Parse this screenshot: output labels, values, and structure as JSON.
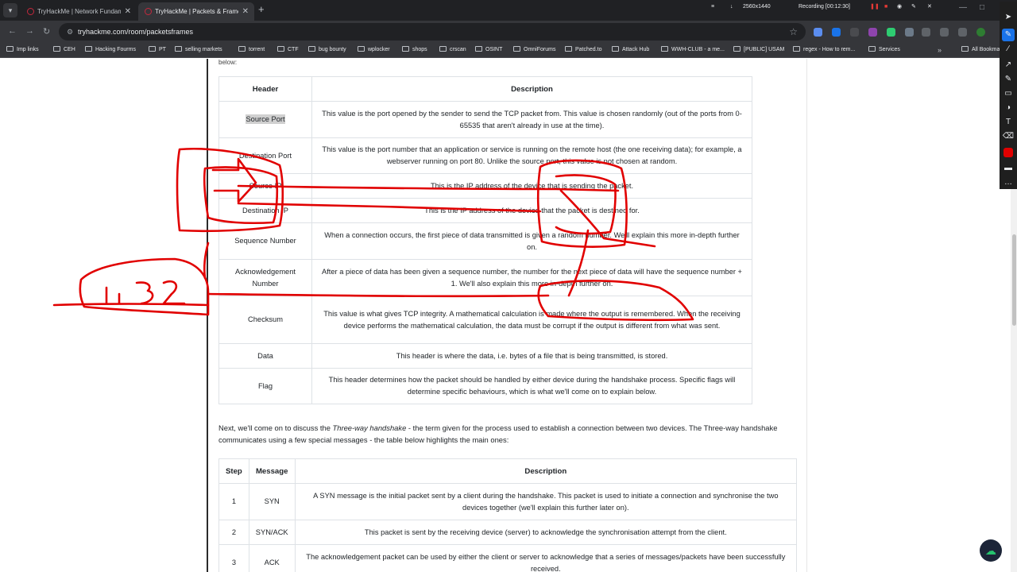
{
  "browser": {
    "tabs": [
      {
        "label": "TryHackMe | Network Fundame",
        "active": false
      },
      {
        "label": "TryHackMe | Packets & Frames",
        "active": true
      }
    ],
    "url": "tryhackme.com/room/packetsframes",
    "recording": {
      "resolution": "2560x1440",
      "status": "Recording [00:12:30]"
    },
    "bookmarks": [
      "Imp links",
      "CEH",
      "Hacking Fourms",
      "PT",
      "selling markets",
      "torrent",
      "CTF",
      "bug bounty",
      "wplocker",
      "shops",
      "crscan",
      "OSINT",
      "OmniForums",
      "Patched.to",
      "Attack Hub",
      "WWH-CLUB - a me...",
      "[PUBLIC] USAM",
      "regex - How to rem...",
      "Services",
      "All Bookmarks"
    ]
  },
  "page": {
    "cut_text": "below:",
    "tcp_table": {
      "headers": [
        "Header",
        "Description"
      ],
      "rows": [
        {
          "header": "Source Port",
          "description": "This value is the port opened by the sender to send the TCP packet from. This value is chosen randomly (out of the ports from 0-65535 that aren't already in use at the time)."
        },
        {
          "header": "Destination Port",
          "description": "This value is the port number that an application or service is running on the remote host (the one receiving data); for example, a webserver running on port 80. Unlike the source port, this value is not chosen at random."
        },
        {
          "header": "Source IP",
          "description": "This is the IP address of the device that is sending the packet."
        },
        {
          "header": "Destination IP",
          "description": "This is the IP address of the device that the packet is destined for."
        },
        {
          "header": "Sequence Number",
          "description": "When a connection occurs, the first piece of data transmitted is given a random number. We'll explain this more in-depth further on."
        },
        {
          "header": "Acknowledgement Number",
          "description": "After a piece of data has been given a sequence number, the number for the next piece of data will have the sequence number + 1. We'll also explain this more in-depth further on."
        },
        {
          "header": "Checksum",
          "description": "This value is what gives TCP integrity. A mathematical calculation is made where the output is remembered. When the receiving device performs the mathematical calculation, the data must be corrupt if the output is different from what was sent."
        },
        {
          "header": "Data",
          "description": "This header is where the data, i.e. bytes of a file that is being transmitted, is stored."
        },
        {
          "header": "Flag",
          "description": "This header determines how the packet should be handled by either device during the handshake process. Specific flags will determine specific behaviours, which is what we'll come on to explain below."
        }
      ]
    },
    "paragraph": {
      "before": "Next, we'll come on to discuss the ",
      "emphasis": "Three-way handshake",
      "after": " - the term given for the process used to establish a connection between two devices. The Three-way handshake communicates using a few special messages - the table below highlights the main ones:"
    },
    "handshake_table": {
      "headers": [
        "Step",
        "Message",
        "Description"
      ],
      "rows": [
        {
          "step": "1",
          "message": "SYN",
          "description": "A SYN message is the initial packet sent by a client during the handshake. This packet is used to initiate a connection and synchronise the two devices together (we'll explain this further later on)."
        },
        {
          "step": "2",
          "message": "SYN/ACK",
          "description": "This packet is sent by the receiving device (server) to acknowledge the synchronisation attempt from the client."
        },
        {
          "step": "3",
          "message": "ACK",
          "description": "The acknowledgement packet can be used by either the client or server to acknowledge that a series of messages/packets have been successfully received."
        }
      ]
    }
  },
  "annotation": {
    "handwritten_label": "1.32"
  },
  "colors": {
    "ink": "#e10000",
    "chrome_dark": "#202124",
    "chrome": "#35363a"
  }
}
